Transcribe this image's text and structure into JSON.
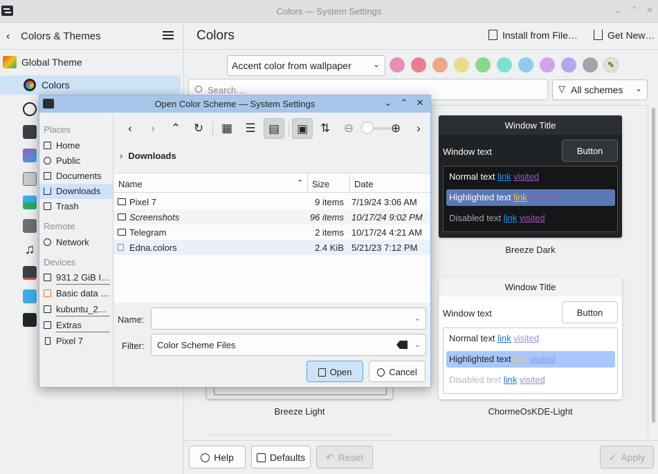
{
  "window": {
    "title": "Colors — System Settings"
  },
  "sidebar": {
    "back_label": "Colors & Themes",
    "items": [
      {
        "label": "Global Theme",
        "icon": "global-theme-icon"
      },
      {
        "label": "Colors",
        "icon": "colors-icon",
        "active": true
      }
    ],
    "other_icons": [
      "plasma-style-icon",
      "window-decorations-icon",
      "fonts-icon",
      "icons-icon",
      "cursors-icon",
      "system-sounds-icon",
      "splash-screen-icon",
      "login-screen-icon",
      "boot-splash-icon"
    ]
  },
  "header": {
    "title": "Colors",
    "install_label": "Install from File…",
    "get_new_label": "Get New…"
  },
  "accent": {
    "mode": "Accent color from wallpaper",
    "swatches": [
      "#e78fb8",
      "#e77f8f",
      "#eca988",
      "#e9dc88",
      "#8ad98b",
      "#7ee0d0",
      "#8fcbef",
      "#d4a4ea",
      "#b7a6ef",
      "#a2a5a8"
    ]
  },
  "search": {
    "placeholder": "Search…",
    "filter": "All schemes"
  },
  "schemes": [
    {
      "name": "Breeze Dark",
      "window_title": "Window Title",
      "window_text": "Window text",
      "button": "Button",
      "normal_text": "Normal text",
      "highlighted_text": "Highlighted text",
      "disabled_text": "Disabled text",
      "link": "link",
      "visited": "visited"
    },
    {
      "name": "ChormeOsKDE-Light",
      "window_title": "Window Title",
      "window_text": "Window text",
      "button": "Button",
      "normal_text": "Normal text",
      "highlighted_text": "Highlighted text",
      "disabled_text": "Disabled text",
      "link": "link",
      "visited": "visited"
    },
    {
      "name": "Breeze Light"
    }
  ],
  "footer": {
    "help": "Help",
    "defaults": "Defaults",
    "reset": "Reset",
    "apply": "Apply"
  },
  "dialog": {
    "title": "Open Color Scheme — System Settings",
    "places_header": "Places",
    "places": [
      "Home",
      "Public",
      "Documents",
      "Downloads",
      "Trash"
    ],
    "remote_header": "Remote",
    "remote": [
      "Network"
    ],
    "devices_header": "Devices",
    "devices": [
      "931.2 GiB I…",
      "Basic data …",
      "kubuntu_2…",
      "Extras",
      "Pixel 7"
    ],
    "breadcrumb": "Downloads",
    "columns": {
      "name": "Name",
      "size": "Size",
      "date": "Date"
    },
    "files": [
      {
        "name": "Pixel 7",
        "size": "9 items",
        "date": "7/19/24 3:06 AM"
      },
      {
        "name": "Screenshots",
        "size": "96 items",
        "date": "10/17/24 9:02 PM"
      },
      {
        "name": "Telegram",
        "size": "2 items",
        "date": "10/17/24 4:21 AM"
      },
      {
        "name": "Edna.colors",
        "size": "2.4 KiB",
        "date": "5/21/23 7:12 PM"
      }
    ],
    "name_label": "Name:",
    "name_value": "",
    "filter_label": "Filter:",
    "filter_value": "Color Scheme Files",
    "open": "Open",
    "cancel": "Cancel"
  }
}
